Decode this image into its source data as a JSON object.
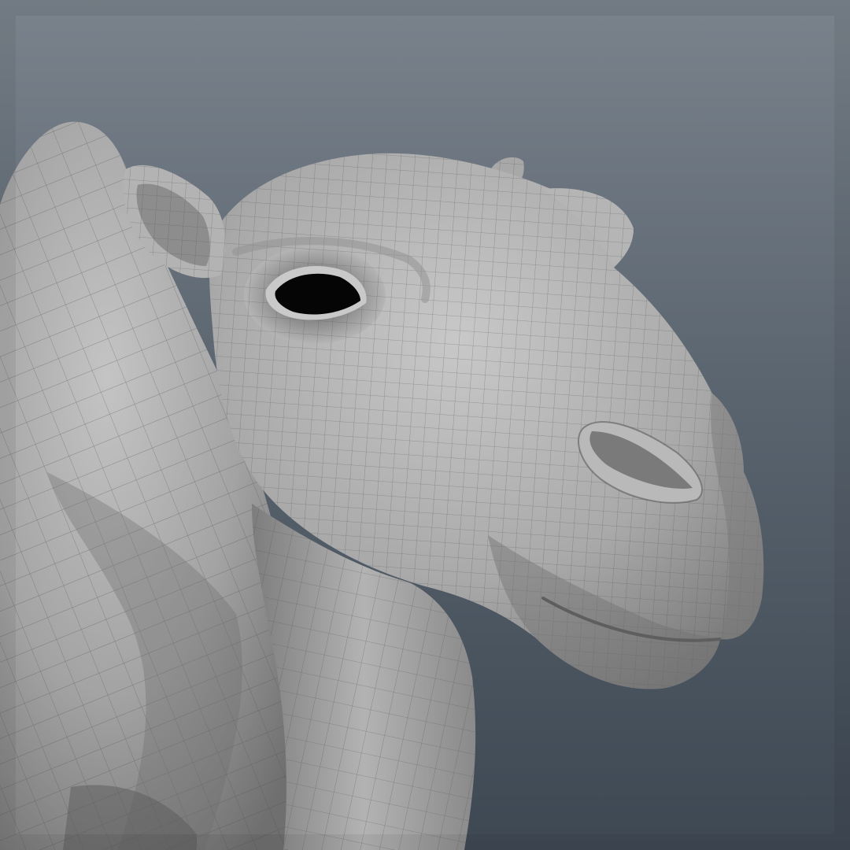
{
  "scene": {
    "subject": "camel-head-wireframe-model",
    "colors": {
      "background_top": "#7a838c",
      "background_mid": "#5b6570",
      "background_bottom": "#3e4853",
      "mesh_light": "#b9b9b9",
      "mesh_mid": "#999999",
      "mesh_dark": "#6c6c6c",
      "wire": "#4e4e4e",
      "eye": "#050505"
    }
  }
}
